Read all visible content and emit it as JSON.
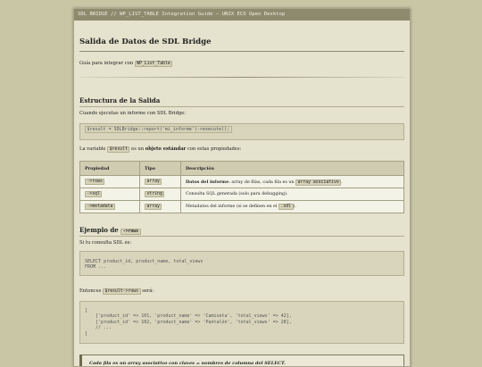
{
  "window": {
    "title": "SDL BRIDGE // WP_LIST_TABLE Integration Guide — UNIX ECO Open Desktop"
  },
  "doc": {
    "title": "Salida de Datos de SDL Bridge",
    "intro_text": "Guía para integrar con",
    "intro_code": "WP_List_Table",
    "section1": {
      "heading": "Estructura de la Salida",
      "text": "Cuando ejecutas un informe con SDL Bridge:",
      "code": "$result = SDLBridge::report('mi_informe')->execute();",
      "var_text_before": "La variable",
      "var_code": "$result",
      "var_text_mid": "es un",
      "var_bold": "objeto estándar",
      "var_text_after": "con estas propiedades:"
    },
    "table": {
      "headers": [
        "Propiedad",
        "Tipo",
        "Descripción"
      ],
      "rows": [
        {
          "prop": "->rows",
          "type": "array",
          "desc_bold": "Datos del informe",
          "desc_text": ": array de filas, cada fila es un",
          "desc_code": "array asociativo",
          "desc_end": "."
        },
        {
          "prop": "->sql",
          "type": "string",
          "desc_text": "Consulta SQL generada (solo para debugging)."
        },
        {
          "prop": "->metadata",
          "type": "array",
          "desc_text": "Metadatos del informe (si se definen en el",
          "desc_code": ".sdl",
          "desc_end": ")."
        }
      ]
    },
    "section2": {
      "heading_text": "Ejemplo de",
      "heading_code": "->rows",
      "text": "Si tu consulta SDL es:",
      "sql_lines": [
        "SELECT product_id, product_name, total_views",
        "FROM ..."
      ],
      "then_text_before": "Entonces",
      "then_code": "$result->rows",
      "then_text_after": "será:",
      "array_lines": [
        "[",
        "    ['product_id' => 101, 'product_name' => 'Camiseta', 'total_views' => 42],",
        "    ['product_id' => 102, 'product_name' => 'Pantalón', 'total_views' => 28],",
        "    // ...",
        "]"
      ]
    },
    "note": "Cada fila es un array asociativo con claves = nombres de columna del SELECT."
  }
}
